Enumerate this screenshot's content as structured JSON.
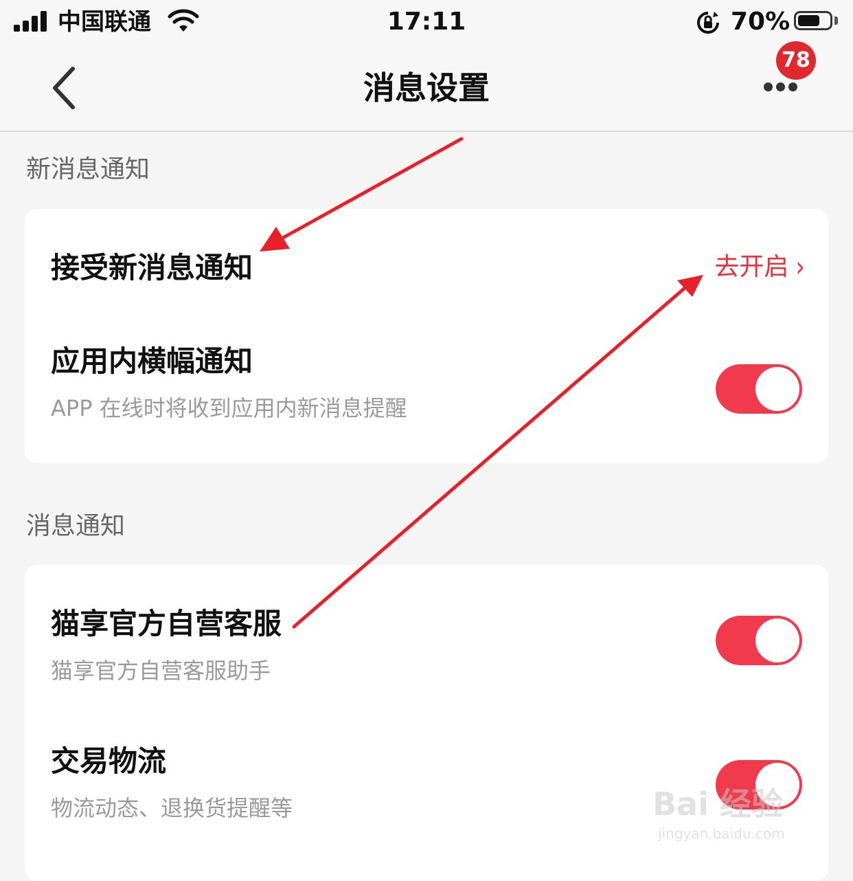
{
  "status_bar": {
    "carrier": "中国联通",
    "time": "17:11",
    "battery_percent": "70%",
    "battery_level": 0.7
  },
  "nav": {
    "title": "消息设置",
    "badge_count": "78"
  },
  "sections": [
    {
      "title": "新消息通知",
      "rows": [
        {
          "title": "接受新消息通知",
          "action_label": "去开启"
        },
        {
          "title": "应用内横幅通知",
          "subtitle": "APP 在线时将收到应用内新消息提醒",
          "toggle_on": true
        }
      ]
    },
    {
      "title": "消息通知",
      "rows": [
        {
          "title": "猫享官方自营客服",
          "subtitle": "猫享官方自营客服助手",
          "toggle_on": true
        },
        {
          "title": "交易物流",
          "subtitle": "物流动态、退换货提醒等",
          "toggle_on": true
        }
      ]
    }
  ],
  "watermark": {
    "brand": "Bai 经验",
    "url": "jingyan.baidu.com"
  },
  "colors": {
    "accent": "#f23a4e",
    "action_text": "#e8303a",
    "arrow": "#e8202a",
    "badge": "#e0282f"
  }
}
